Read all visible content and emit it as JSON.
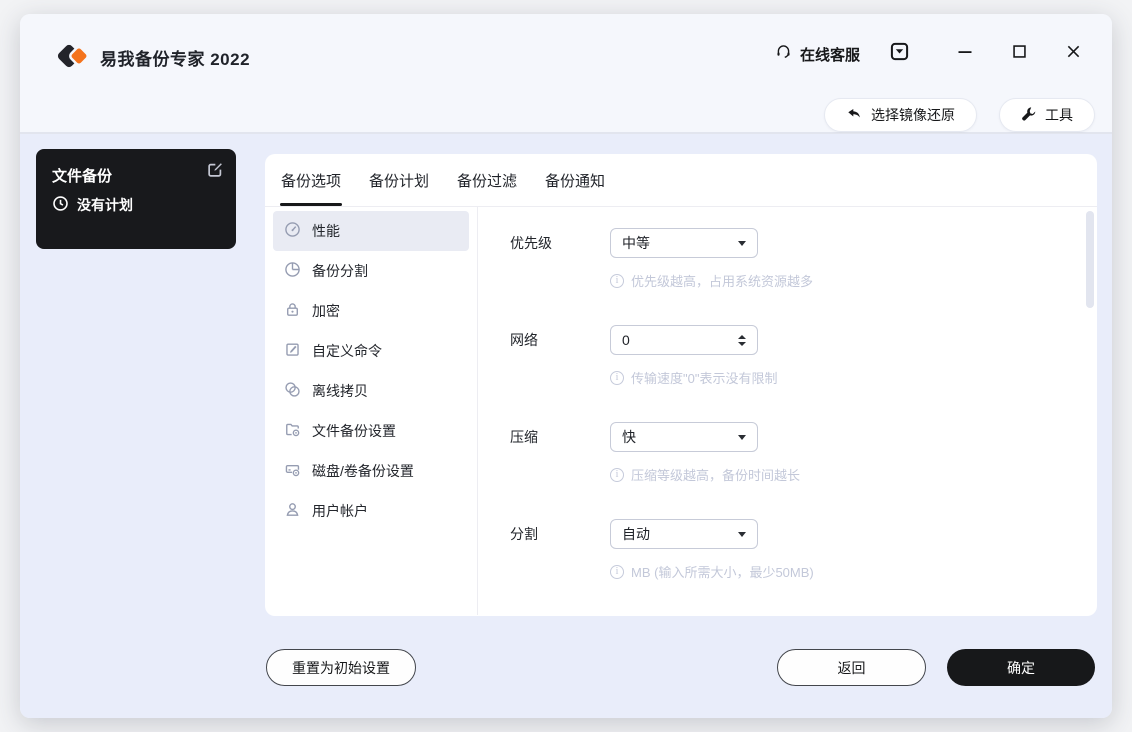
{
  "window": {
    "title": "易我备份专家 2022",
    "support_label": "在线客服",
    "actions": {
      "restore_label": "选择镜像还原",
      "tools_label": "工具"
    }
  },
  "plan_card": {
    "title": "文件备份",
    "subtitle": "没有计划"
  },
  "tabs": [
    {
      "label": "备份选项",
      "active": true
    },
    {
      "label": "备份计划",
      "active": false
    },
    {
      "label": "备份过滤",
      "active": false
    },
    {
      "label": "备份通知",
      "active": false
    }
  ],
  "sidebar": {
    "items": [
      {
        "label": "性能",
        "icon": "gauge-icon",
        "active": true
      },
      {
        "label": "备份分割",
        "icon": "pie-chart-icon",
        "active": false
      },
      {
        "label": "加密",
        "icon": "lock-icon",
        "active": false
      },
      {
        "label": "自定义命令",
        "icon": "edit-square-icon",
        "active": false
      },
      {
        "label": "离线拷贝",
        "icon": "discs-icon",
        "active": false
      },
      {
        "label": "文件备份设置",
        "icon": "folder-gear-icon",
        "active": false
      },
      {
        "label": "磁盘/卷备份设置",
        "icon": "disk-gear-icon",
        "active": false
      },
      {
        "label": "用户帐户",
        "icon": "user-icon",
        "active": false
      }
    ]
  },
  "form": {
    "rows": [
      {
        "label": "优先级",
        "control": "select",
        "value": "中等",
        "hint": "优先级越高，占用系统资源越多"
      },
      {
        "label": "网络",
        "control": "spinner",
        "value": "0",
        "hint": "传输速度\"0\"表示没有限制"
      },
      {
        "label": "压缩",
        "control": "select",
        "value": "快",
        "hint": "压缩等级越高，备份时间越长"
      },
      {
        "label": "分割",
        "control": "select",
        "value": "自动",
        "hint": "MB (输入所需大小，最少50MB)"
      }
    ]
  },
  "footer": {
    "reset_label": "重置为初始设置",
    "back_label": "返回",
    "confirm_label": "确定"
  },
  "icons": [
    "headset-icon",
    "tray-arrow-icon",
    "minimize-icon",
    "maximize-icon",
    "close-icon",
    "reply-arrow-icon",
    "wrench-icon",
    "edit-icon",
    "clock-icon",
    "info-icon",
    "caret-down-icon",
    "spinner-arrows-icon"
  ],
  "colors": {
    "accent_orange": "#f4731c",
    "dark": "#17181a",
    "header_bg": "#f5f7fc",
    "main_bg": "#e9edfa",
    "panel_bg": "#ffffff",
    "hint_text": "#c3c8d9",
    "sidebar_active_bg": "#e9ebf3"
  }
}
